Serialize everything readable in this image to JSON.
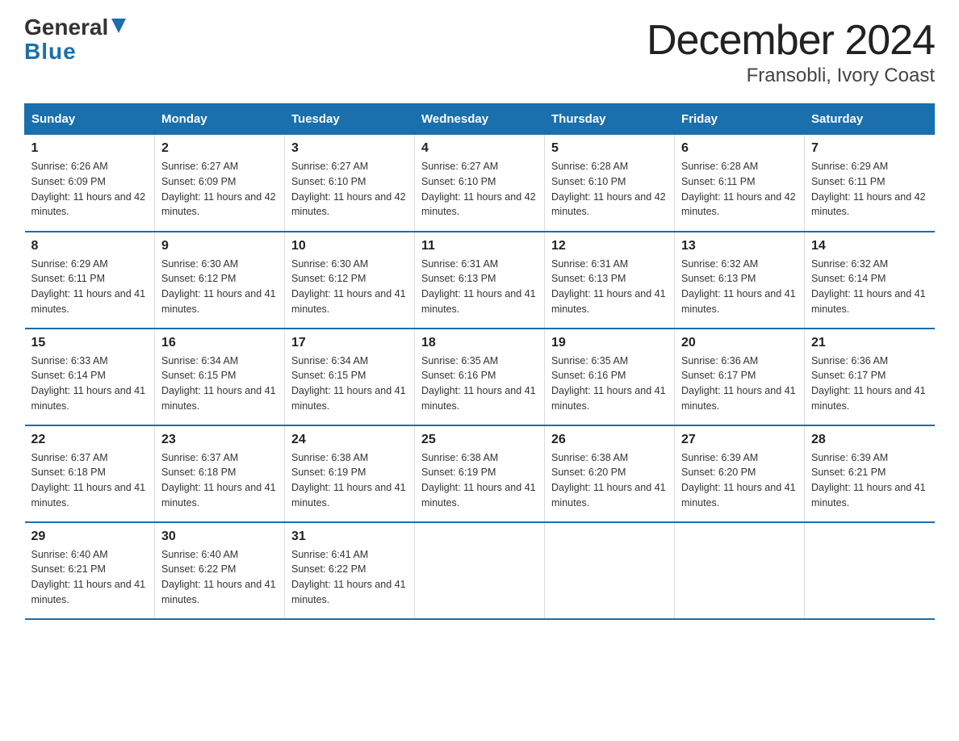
{
  "logo": {
    "text1": "General",
    "text2": "Blue"
  },
  "title": "December 2024",
  "subtitle": "Fransobli, Ivory Coast",
  "days_header": [
    "Sunday",
    "Monday",
    "Tuesday",
    "Wednesday",
    "Thursday",
    "Friday",
    "Saturday"
  ],
  "weeks": [
    [
      {
        "day": "1",
        "sunrise": "Sunrise: 6:26 AM",
        "sunset": "Sunset: 6:09 PM",
        "daylight": "Daylight: 11 hours and 42 minutes."
      },
      {
        "day": "2",
        "sunrise": "Sunrise: 6:27 AM",
        "sunset": "Sunset: 6:09 PM",
        "daylight": "Daylight: 11 hours and 42 minutes."
      },
      {
        "day": "3",
        "sunrise": "Sunrise: 6:27 AM",
        "sunset": "Sunset: 6:10 PM",
        "daylight": "Daylight: 11 hours and 42 minutes."
      },
      {
        "day": "4",
        "sunrise": "Sunrise: 6:27 AM",
        "sunset": "Sunset: 6:10 PM",
        "daylight": "Daylight: 11 hours and 42 minutes."
      },
      {
        "day": "5",
        "sunrise": "Sunrise: 6:28 AM",
        "sunset": "Sunset: 6:10 PM",
        "daylight": "Daylight: 11 hours and 42 minutes."
      },
      {
        "day": "6",
        "sunrise": "Sunrise: 6:28 AM",
        "sunset": "Sunset: 6:11 PM",
        "daylight": "Daylight: 11 hours and 42 minutes."
      },
      {
        "day": "7",
        "sunrise": "Sunrise: 6:29 AM",
        "sunset": "Sunset: 6:11 PM",
        "daylight": "Daylight: 11 hours and 42 minutes."
      }
    ],
    [
      {
        "day": "8",
        "sunrise": "Sunrise: 6:29 AM",
        "sunset": "Sunset: 6:11 PM",
        "daylight": "Daylight: 11 hours and 41 minutes."
      },
      {
        "day": "9",
        "sunrise": "Sunrise: 6:30 AM",
        "sunset": "Sunset: 6:12 PM",
        "daylight": "Daylight: 11 hours and 41 minutes."
      },
      {
        "day": "10",
        "sunrise": "Sunrise: 6:30 AM",
        "sunset": "Sunset: 6:12 PM",
        "daylight": "Daylight: 11 hours and 41 minutes."
      },
      {
        "day": "11",
        "sunrise": "Sunrise: 6:31 AM",
        "sunset": "Sunset: 6:13 PM",
        "daylight": "Daylight: 11 hours and 41 minutes."
      },
      {
        "day": "12",
        "sunrise": "Sunrise: 6:31 AM",
        "sunset": "Sunset: 6:13 PM",
        "daylight": "Daylight: 11 hours and 41 minutes."
      },
      {
        "day": "13",
        "sunrise": "Sunrise: 6:32 AM",
        "sunset": "Sunset: 6:13 PM",
        "daylight": "Daylight: 11 hours and 41 minutes."
      },
      {
        "day": "14",
        "sunrise": "Sunrise: 6:32 AM",
        "sunset": "Sunset: 6:14 PM",
        "daylight": "Daylight: 11 hours and 41 minutes."
      }
    ],
    [
      {
        "day": "15",
        "sunrise": "Sunrise: 6:33 AM",
        "sunset": "Sunset: 6:14 PM",
        "daylight": "Daylight: 11 hours and 41 minutes."
      },
      {
        "day": "16",
        "sunrise": "Sunrise: 6:34 AM",
        "sunset": "Sunset: 6:15 PM",
        "daylight": "Daylight: 11 hours and 41 minutes."
      },
      {
        "day": "17",
        "sunrise": "Sunrise: 6:34 AM",
        "sunset": "Sunset: 6:15 PM",
        "daylight": "Daylight: 11 hours and 41 minutes."
      },
      {
        "day": "18",
        "sunrise": "Sunrise: 6:35 AM",
        "sunset": "Sunset: 6:16 PM",
        "daylight": "Daylight: 11 hours and 41 minutes."
      },
      {
        "day": "19",
        "sunrise": "Sunrise: 6:35 AM",
        "sunset": "Sunset: 6:16 PM",
        "daylight": "Daylight: 11 hours and 41 minutes."
      },
      {
        "day": "20",
        "sunrise": "Sunrise: 6:36 AM",
        "sunset": "Sunset: 6:17 PM",
        "daylight": "Daylight: 11 hours and 41 minutes."
      },
      {
        "day": "21",
        "sunrise": "Sunrise: 6:36 AM",
        "sunset": "Sunset: 6:17 PM",
        "daylight": "Daylight: 11 hours and 41 minutes."
      }
    ],
    [
      {
        "day": "22",
        "sunrise": "Sunrise: 6:37 AM",
        "sunset": "Sunset: 6:18 PM",
        "daylight": "Daylight: 11 hours and 41 minutes."
      },
      {
        "day": "23",
        "sunrise": "Sunrise: 6:37 AM",
        "sunset": "Sunset: 6:18 PM",
        "daylight": "Daylight: 11 hours and 41 minutes."
      },
      {
        "day": "24",
        "sunrise": "Sunrise: 6:38 AM",
        "sunset": "Sunset: 6:19 PM",
        "daylight": "Daylight: 11 hours and 41 minutes."
      },
      {
        "day": "25",
        "sunrise": "Sunrise: 6:38 AM",
        "sunset": "Sunset: 6:19 PM",
        "daylight": "Daylight: 11 hours and 41 minutes."
      },
      {
        "day": "26",
        "sunrise": "Sunrise: 6:38 AM",
        "sunset": "Sunset: 6:20 PM",
        "daylight": "Daylight: 11 hours and 41 minutes."
      },
      {
        "day": "27",
        "sunrise": "Sunrise: 6:39 AM",
        "sunset": "Sunset: 6:20 PM",
        "daylight": "Daylight: 11 hours and 41 minutes."
      },
      {
        "day": "28",
        "sunrise": "Sunrise: 6:39 AM",
        "sunset": "Sunset: 6:21 PM",
        "daylight": "Daylight: 11 hours and 41 minutes."
      }
    ],
    [
      {
        "day": "29",
        "sunrise": "Sunrise: 6:40 AM",
        "sunset": "Sunset: 6:21 PM",
        "daylight": "Daylight: 11 hours and 41 minutes."
      },
      {
        "day": "30",
        "sunrise": "Sunrise: 6:40 AM",
        "sunset": "Sunset: 6:22 PM",
        "daylight": "Daylight: 11 hours and 41 minutes."
      },
      {
        "day": "31",
        "sunrise": "Sunrise: 6:41 AM",
        "sunset": "Sunset: 6:22 PM",
        "daylight": "Daylight: 11 hours and 41 minutes."
      },
      null,
      null,
      null,
      null
    ]
  ]
}
